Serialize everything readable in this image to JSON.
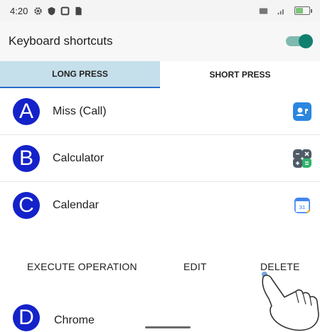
{
  "status_bar": {
    "time": "4:20",
    "icons_left": [
      "gear-icon",
      "shield-icon",
      "square-icon",
      "sim-icon"
    ],
    "icons_right": [
      "hd-icon",
      "signal-icon",
      "battery-icon"
    ],
    "battery_level_percent": 60,
    "battery_color": "#7cc47a"
  },
  "header": {
    "title": "Keyboard shortcuts",
    "toggle_on": true,
    "accent_color": "#11806f"
  },
  "tabs": [
    {
      "label": "LONG PRESS",
      "active": true
    },
    {
      "label": "SHORT PRESS",
      "active": false
    }
  ],
  "shortcuts": [
    {
      "letter": "A",
      "label": "Miss (Call)",
      "icon": "contacts-icon"
    },
    {
      "letter": "B",
      "label": "Calculator",
      "icon": "calculator-icon"
    },
    {
      "letter": "C",
      "label": "Calendar",
      "icon": "calendar-icon"
    },
    {
      "letter": "D",
      "label": "Chrome",
      "icon": ""
    }
  ],
  "calendar_icon_day": "31",
  "actions": {
    "execute": "EXECUTE OPERATION",
    "edit": "EDIT",
    "delete": "DELETE"
  },
  "overlay": {
    "icon": "pointing-hand-icon"
  },
  "colors": {
    "letter_badge": "#1422c9",
    "active_tab": "#c5dfeb",
    "tab_underline": "#2f6bcf"
  }
}
